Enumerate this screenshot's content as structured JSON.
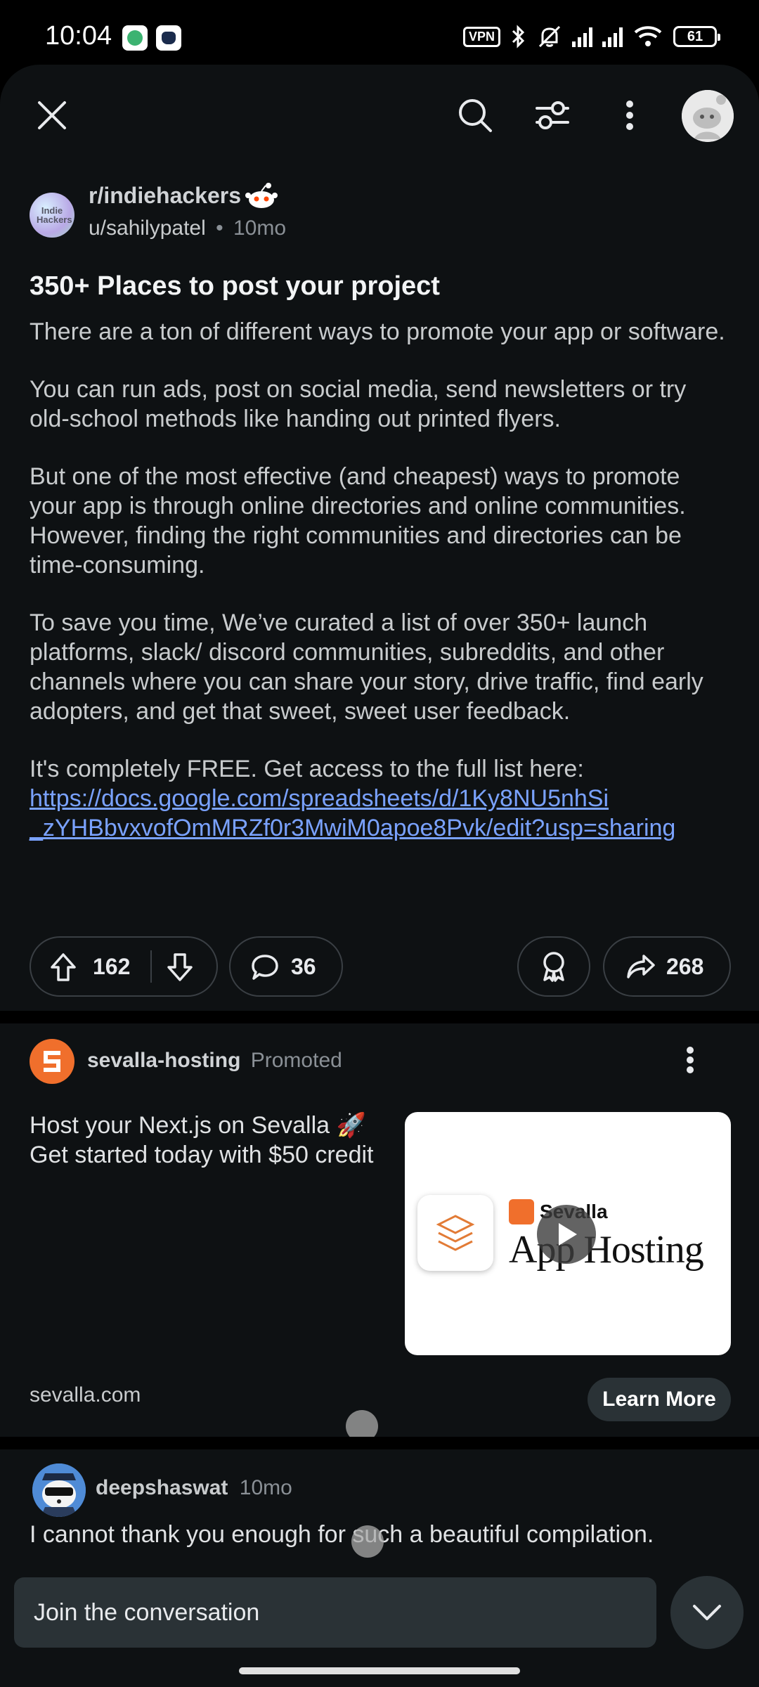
{
  "status_bar": {
    "time": "10:04",
    "vpn": "VPN",
    "battery": "61"
  },
  "post": {
    "subreddit": "r/indiehackers",
    "subreddit_avatar_text": "Indie Hackers",
    "author": "u/sahilypatel",
    "separator": "•",
    "age": "10mo",
    "title": "350+ Places to post your project",
    "paragraphs": [
      "There are a ton of different ways to promote your app or software.",
      "You can run ads, post on social media, send newsletters or try old-school methods like handing out printed flyers.",
      "But one of the most effective (and cheapest) ways to promote your app is through online directories and online communities. However, finding the right communities and directories can be time-consuming.",
      "To save you time, We’ve curated a list of over 350+ launch platforms, slack/ discord communities, subreddits, and other channels where you can share your story, drive traffic, find early adopters, and get that sweet, sweet user feedback."
    ],
    "cta_text": "It's completely FREE. Get access to the full list here:",
    "link_line1": "https://docs.google.com/spreadsheets/d/1Ky8NU5nhSi",
    "link_line2": "_zYHBbvxvofOmMRZf0r3MwiM0apoe8Pvk/edit?usp=sharing",
    "upvotes": "162",
    "comments": "36",
    "shares": "268"
  },
  "ad": {
    "advertiser": "sevalla-hosting",
    "label": "Promoted",
    "text": "Host your Next.js on Sevalla 🚀 Get started today with $50 credit",
    "domain": "sevalla.com",
    "button": "Learn More",
    "thumb_brand": "Sevalla",
    "thumb_title": "App Hosting"
  },
  "comment": {
    "author": "deepshaswat",
    "age": "10mo",
    "text": "I cannot thank you enough for such a beautiful compilation."
  },
  "composer": {
    "placeholder": "Join the conversation"
  },
  "colors": {
    "background": "#0e1113",
    "link": "#7aa2ff",
    "ad_accent": "#f06f2c"
  }
}
